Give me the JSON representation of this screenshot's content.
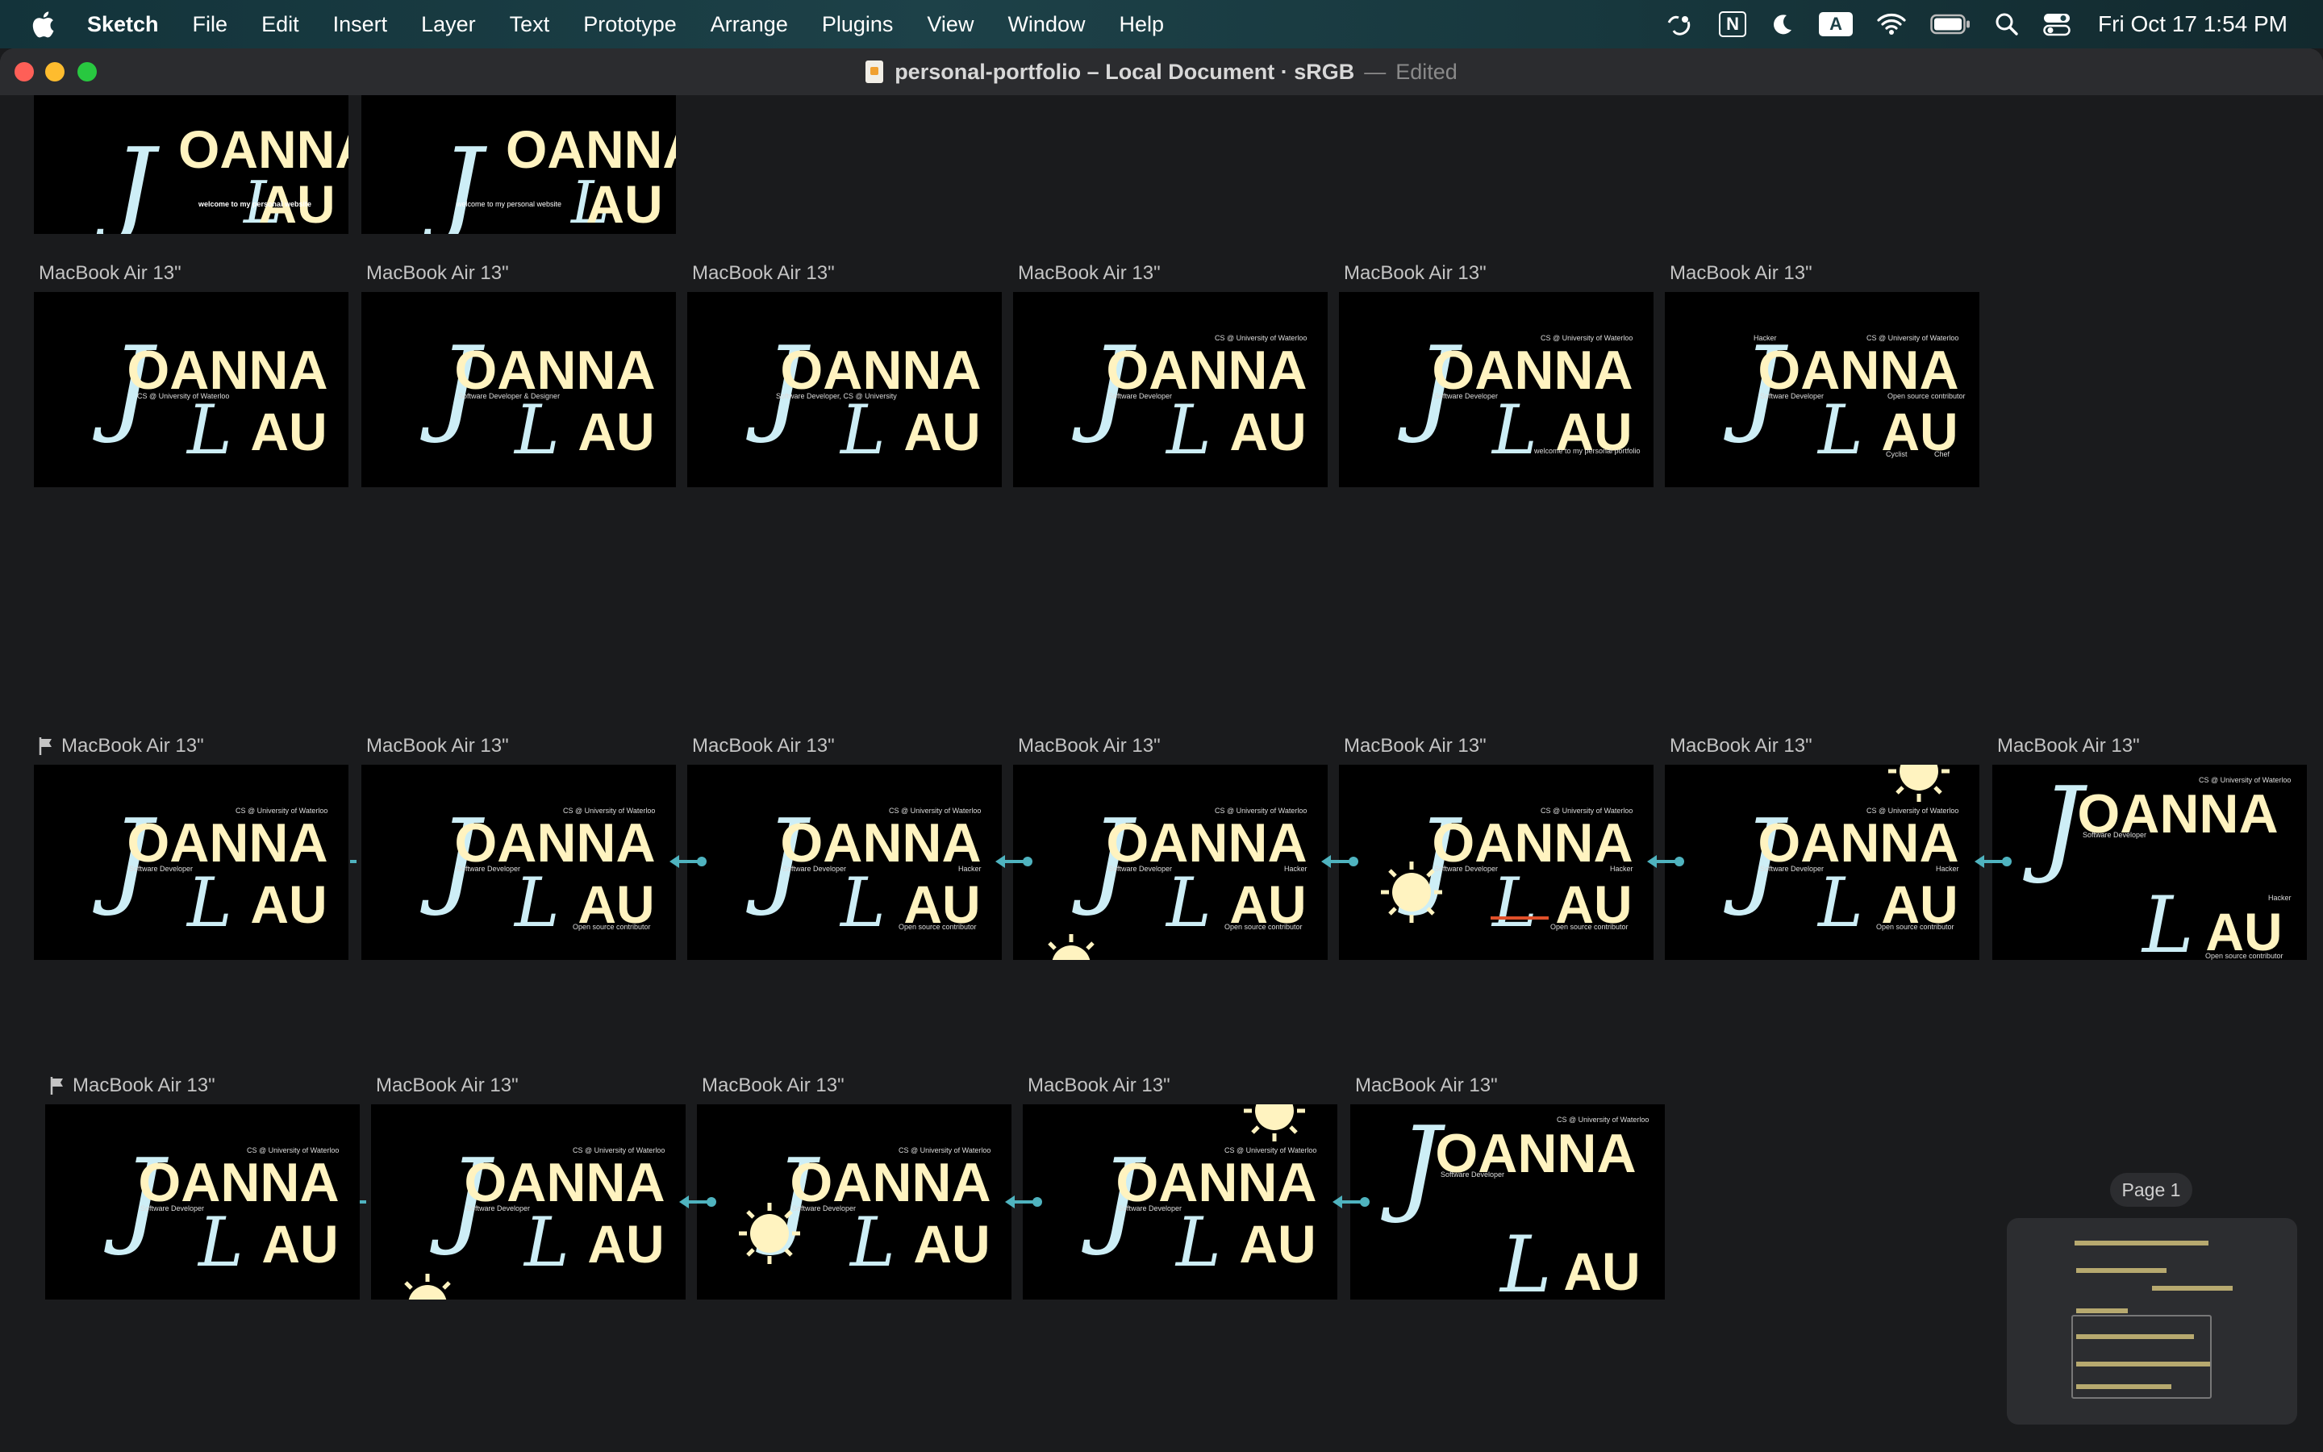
{
  "menubar": {
    "app": "Sketch",
    "items": [
      "File",
      "Edit",
      "Insert",
      "Layer",
      "Text",
      "Prototype",
      "Arrange",
      "Plugins",
      "View",
      "Window",
      "Help"
    ],
    "keyboard_badge": "A",
    "notion_badge": "N",
    "clock": "Fri Oct 17  1:54 PM"
  },
  "window": {
    "doc_name": "personal-portfolio – Local Document · sRGB",
    "separator": "—",
    "edited": "Edited"
  },
  "artboard_label": "MacBook Air 13\"",
  "page_pill": "Page 1",
  "colors": {
    "cream": "#fff3c0",
    "script": "#cdeef6",
    "connector": "#4fb3bf"
  },
  "design": {
    "first": "OANNA",
    "last": "AU",
    "j": "J",
    "l": "L",
    "subtitles": [
      "welcome to my personal website",
      "welcome to my personal website",
      "CS @ University of Waterloo",
      "Software Developer & Designer",
      "Software Developer, CS @ University",
      "Software Developer",
      "Software Developer",
      "Software Developer"
    ],
    "tag_cs": "CS @ University of Waterloo",
    "tag_dev": "Software Developer",
    "tag_hacker": "Hacker",
    "tag_oss": "Open source contributor",
    "tag_welcome": "welcome to my personal portfolio",
    "tag_cyclist": "Cyclist",
    "tag_chef": "Chef"
  }
}
